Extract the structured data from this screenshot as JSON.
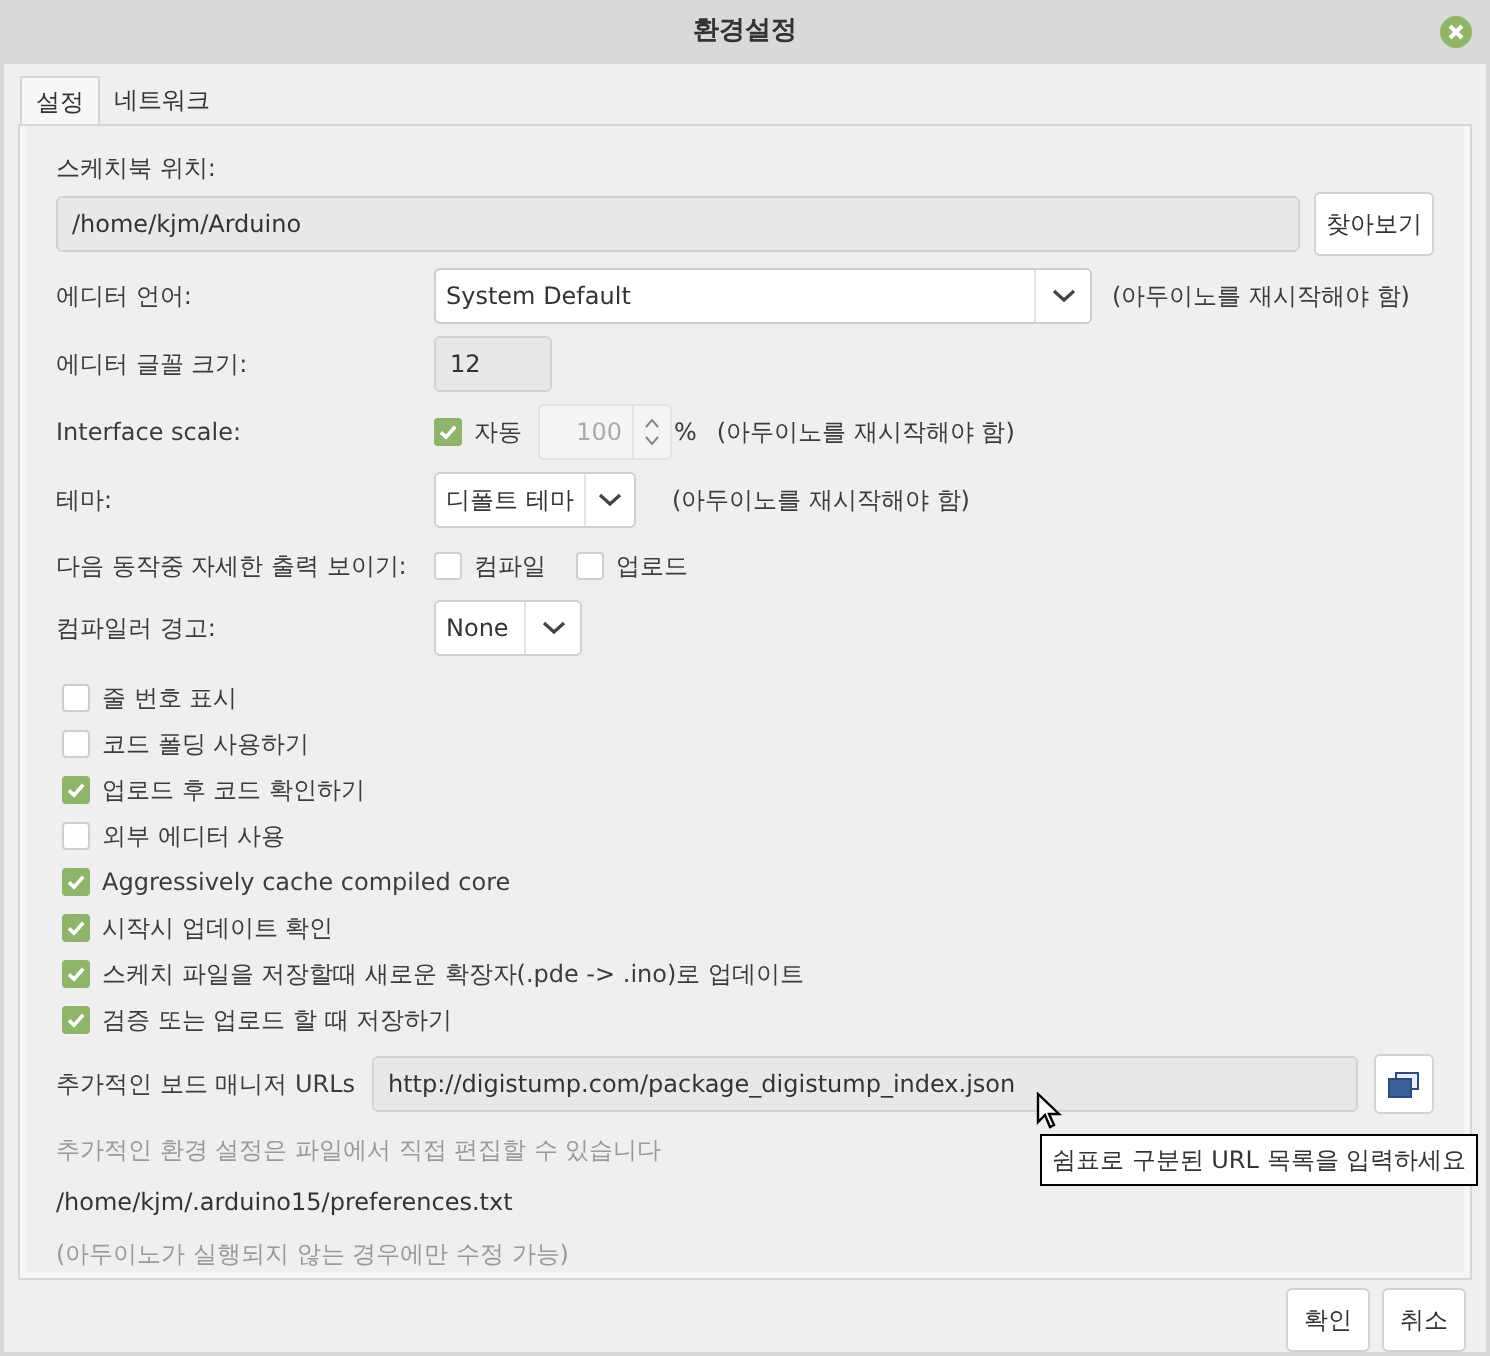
{
  "window": {
    "title": "환경설정"
  },
  "tabs": [
    {
      "label": "설정",
      "selected": true
    },
    {
      "label": "네트워크",
      "selected": false
    }
  ],
  "sketchbook": {
    "label": "스케치북 위치:",
    "value": "/home/kjm/Arduino",
    "browse_button": "찾아보기"
  },
  "editor_language": {
    "label": "에디터 언어:",
    "value": "System Default",
    "note": "(아두이노를 재시작해야 함)"
  },
  "editor_font_size": {
    "label": "에디터 글꼴 크기:",
    "value": "12"
  },
  "interface_scale": {
    "label": "Interface scale:",
    "auto_label": "자동",
    "auto_checked": true,
    "value": "100",
    "unit": "%",
    "note": "(아두이노를 재시작해야 함)"
  },
  "theme": {
    "label": "테마:",
    "value": "디폴트 테마",
    "note": "(아두이노를 재시작해야 함)"
  },
  "verbose_output": {
    "label": "다음 동작중 자세한  출력 보이기:",
    "options": [
      {
        "label": "컴파일",
        "checked": false
      },
      {
        "label": "업로드",
        "checked": false
      }
    ]
  },
  "compiler_warnings": {
    "label": "컴파일러 경고:",
    "value": "None"
  },
  "options": [
    {
      "label": "줄 번호 표시",
      "checked": false
    },
    {
      "label": "코드 폴딩 사용하기",
      "checked": false
    },
    {
      "label": "업로드 후 코드 확인하기",
      "checked": true
    },
    {
      "label": "외부 에디터 사용",
      "checked": false
    },
    {
      "label": "Aggressively cache compiled core",
      "checked": true
    },
    {
      "label": "시작시 업데이트 확인",
      "checked": true
    },
    {
      "label": "스케치 파일을 저장할때 새로운 확장자(.pde -> .ino)로 업데이트",
      "checked": true
    },
    {
      "label": "검증 또는 업로드 할 때 저장하기",
      "checked": true
    }
  ],
  "board_manager_urls": {
    "label": "추가적인 보드 매니저 URLs",
    "value": "http://digistump.com/package_digistump_index.json",
    "tooltip": "쉼표로 구분된 URL 목록을 입력하세요"
  },
  "more_preferences": {
    "hint": "추가적인 환경 설정은 파일에서 직접 편집할 수 있습니다",
    "path": "/home/kjm/.arduino15/preferences.txt",
    "note": "(아두이노가 실행되지 않는 경우에만 수정 가능)"
  },
  "buttons": [
    "확인",
    "취소"
  ]
}
